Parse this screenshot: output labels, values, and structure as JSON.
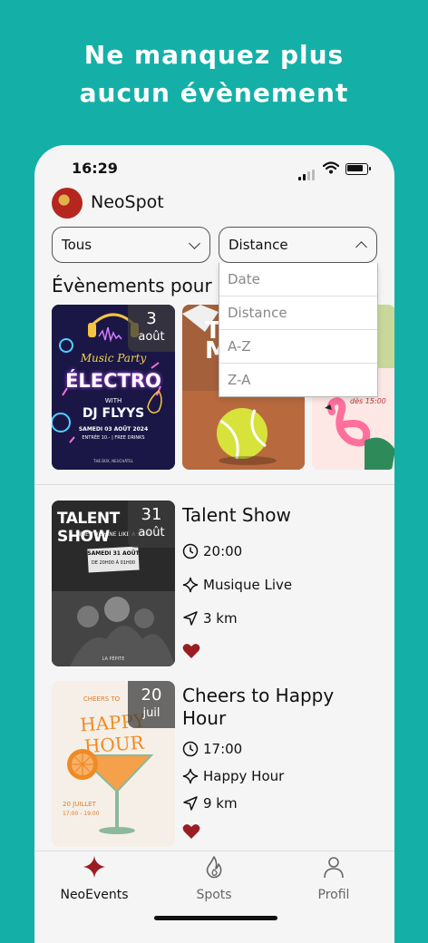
{
  "promo": {
    "headline_line1": "Ne manquez plus",
    "headline_line2": "aucun évènement"
  },
  "status": {
    "time": "16:29"
  },
  "app": {
    "name": "NeoSpot"
  },
  "filters": {
    "category": "Tous",
    "sort": "Distance",
    "sort_options": [
      "Date",
      "Distance",
      "A-Z",
      "Z-A"
    ]
  },
  "featured": {
    "title": "Évènements pour",
    "cards": [
      {
        "day": "3",
        "month": "août",
        "poster_title": "Music Party",
        "poster_main": "ÉLECTRO",
        "poster_with": "WITH",
        "poster_dj": "DJ FLYYS",
        "poster_date": "SAMEDI 03 AOÛT 2024",
        "poster_entry": "ENTRÉE 10.- | FREE DRINKS",
        "poster_venue": "THE BOX, NEUCHÂTEL"
      },
      {
        "poster_text": "T\nM"
      },
      {
        "poster_text": "dès 15:00"
      }
    ]
  },
  "events": [
    {
      "day": "31",
      "month": "août",
      "title": "Talent Show",
      "time": "20:00",
      "category": "Musique Live",
      "distance": "3 km",
      "poster_title": "TALENT SHOW",
      "poster_sub": "TIME TO SHINE LIKE A STAR",
      "poster_date": "SAMEDI 31 AOÛT",
      "poster_hours": "DE 20H00 À 01H00",
      "poster_venue": "LA PÉPITE"
    },
    {
      "day": "20",
      "month": "juil",
      "title": "Cheers to Happy Hour",
      "time": "17:00",
      "category": "Happy Hour",
      "distance": "9 km",
      "poster_top": "CHEERS TO",
      "poster_title": "HAPPY HOUR",
      "poster_date": "20 JUILLET",
      "poster_hours": "17:00 - 19:00"
    }
  ],
  "tabs": [
    {
      "label": "NeoEvents",
      "active": true
    },
    {
      "label": "Spots",
      "active": false
    },
    {
      "label": "Profil",
      "active": false
    }
  ],
  "colors": {
    "background": "#14b0a8",
    "accent": "#9b1d24",
    "card_bg": "#f5f5f5"
  }
}
